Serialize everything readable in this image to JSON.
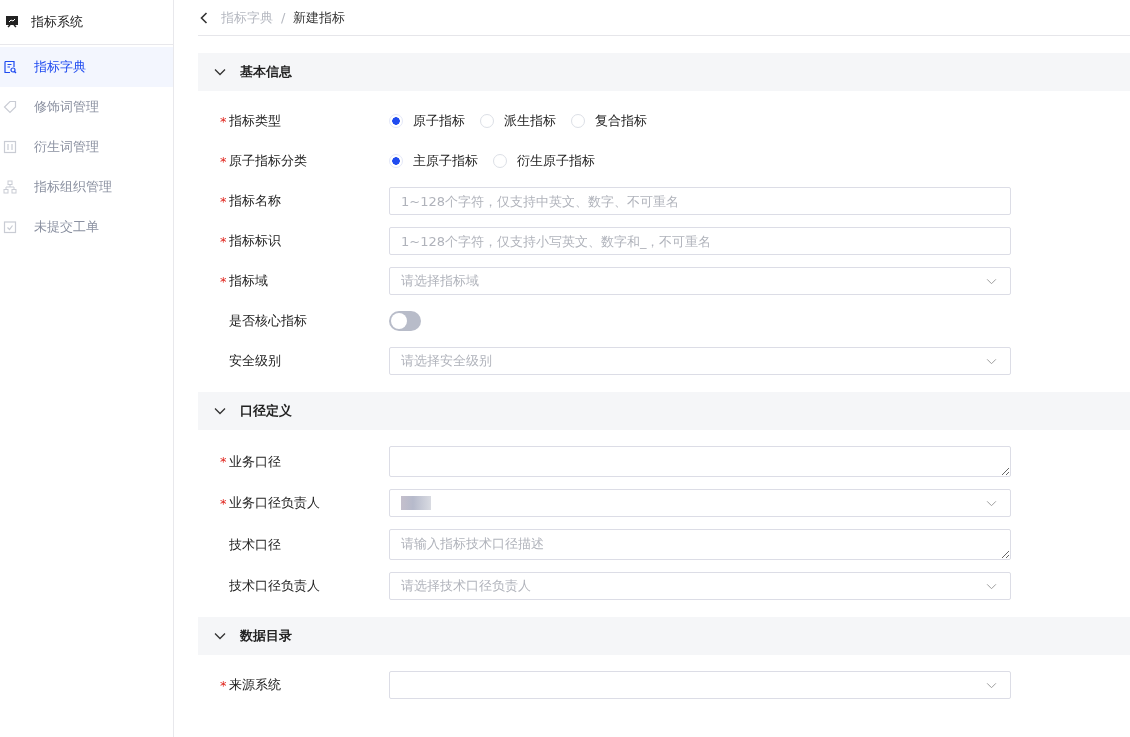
{
  "sidebar": {
    "title": "指标系统",
    "items": [
      {
        "label": "指标字典",
        "kind": "dictionary",
        "selected": true
      },
      {
        "label": "修饰词管理",
        "kind": "tag",
        "selected": false
      },
      {
        "label": "衍生词管理",
        "kind": "sliders",
        "selected": false
      },
      {
        "label": "指标组织管理",
        "kind": "org",
        "selected": false
      },
      {
        "label": "未提交工单",
        "kind": "calendar",
        "selected": false
      }
    ]
  },
  "breadcrumb": {
    "parent": "指标字典",
    "separator": "/",
    "current": "新建指标"
  },
  "sections": [
    {
      "title": "基本信息",
      "expanded": true,
      "fields": [
        {
          "label": "指标类型",
          "required_mark": "*",
          "kind": "radio",
          "options": [
            {
              "label": "原子指标",
              "selected": true
            },
            {
              "label": "派生指标",
              "selected": false
            },
            {
              "label": "复合指标",
              "selected": false
            }
          ]
        },
        {
          "label": "原子指标分类",
          "required_mark": "*",
          "kind": "radio",
          "options": [
            {
              "label": "主原子指标",
              "selected": true
            },
            {
              "label": "衍生原子指标",
              "selected": false
            }
          ]
        },
        {
          "label": "指标名称",
          "required_mark": "*",
          "kind": "input",
          "placeholder": "1~128个字符，仅支持中英文、数字、不可重名"
        },
        {
          "label": "指标标识",
          "required_mark": "*",
          "kind": "input",
          "placeholder": "1~128个字符，仅支持小写英文、数字和_，不可重名"
        },
        {
          "label": "指标域",
          "required_mark": "*",
          "kind": "select",
          "placeholder": "请选择指标域"
        },
        {
          "label": "是否核心指标",
          "kind": "switch",
          "on": false
        },
        {
          "label": "安全级别",
          "kind": "select",
          "placeholder": "请选择安全级别"
        }
      ]
    },
    {
      "title": "口径定义",
      "expanded": true,
      "fields": [
        {
          "label": "业务口径",
          "required_mark": "*",
          "kind": "textarea"
        },
        {
          "label": "业务口径负责人",
          "required_mark": "*",
          "kind": "select",
          "value_blurred": true
        },
        {
          "label": "技术口径",
          "kind": "textarea",
          "placeholder": "请输入指标技术口径描述"
        },
        {
          "label": "技术口径负责人",
          "kind": "select",
          "placeholder": "请选择技术口径负责人"
        }
      ]
    },
    {
      "title": "数据目录",
      "expanded": true,
      "fields": [
        {
          "label": "来源系统",
          "required_mark": "*",
          "kind": "select"
        }
      ]
    }
  ]
}
